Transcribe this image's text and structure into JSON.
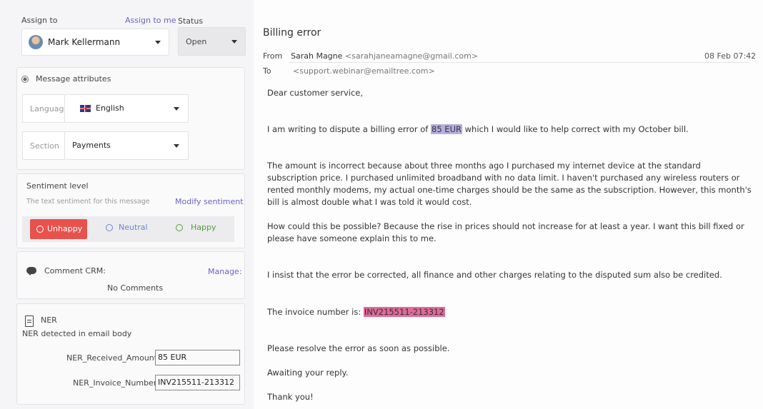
{
  "assign": {
    "label": "Assign to",
    "assign_me": "Assign to me",
    "assignee": "Mark Kellermann"
  },
  "status": {
    "label": "Status",
    "value": "Open"
  },
  "attributes": {
    "title": "Message attributes",
    "language_label": "Language",
    "language_value": "English",
    "section_label": "Section",
    "section_value": "Payments"
  },
  "sentiment": {
    "title": "Sentiment level",
    "subtitle": "The text sentiment for this message",
    "modify": "Modify sentiment",
    "unhappy": "Unhappy",
    "neutral": "Neutral",
    "happy": "Happy",
    "colors": {
      "unhappy": "#e8524d",
      "neutral": "#6d86c9",
      "happy": "#5a9a3e"
    }
  },
  "crm": {
    "title": "Comment CRM:",
    "manage": "Manage:",
    "empty": "No Comments"
  },
  "ner": {
    "title": "NER",
    "subtitle": "NER detected in email body",
    "fields": [
      {
        "label": "NER_Received_Amount",
        "value": "85 EUR"
      },
      {
        "label": "NER_Invoice_Number",
        "value": "INV215511-213312"
      }
    ]
  },
  "email": {
    "subject": "Billing error",
    "from_label": "From",
    "from_name": "Sarah Magne",
    "from_address": "<sarahjaneamagne@gmail.com>",
    "date": "08 Feb 07:42",
    "to_label": "To",
    "to_address": "<support.webinar@emailtree.com>",
    "greeting": "Dear customer service,",
    "p1_before": "I am writing to dispute a billing error of ",
    "p1_amount": "85 EUR",
    "p1_after": " which I would like to help correct with my October bill.",
    "p2": "The amount is incorrect because about three months ago I purchased my internet device at the standard subscription price. I purchased unlimited broadband with no data limit. I haven't purchased any wireless routers or rented monthly modems, my actual one-time charges should be the same as the subscription. However, this month's bill is almost double what I was told it would cost.",
    "p3": "How could this be possible? Because the rise in prices should not increase for at least a year. I want this bill fixed or please have someone explain this to me.",
    "p4": " I insist that the error be corrected, all finance and other charges relating to the disputed sum also be credited.",
    "p5_before": "The invoice number is: ",
    "p5_invoice": "INV215511-213312",
    "p6": "Please resolve the error as soon as possible.",
    "p7": "Awaiting your reply.",
    "p8": "Thank you!"
  }
}
